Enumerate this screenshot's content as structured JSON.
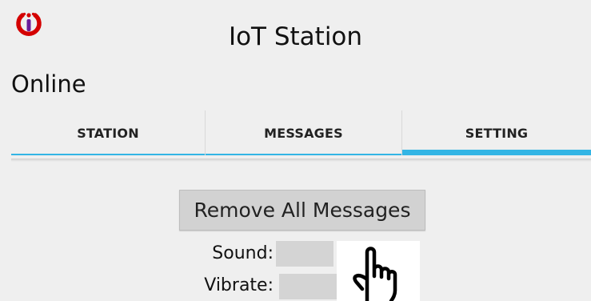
{
  "header": {
    "title": "IoT Station",
    "status": "Online",
    "logo_icon": "power-logo-icon",
    "logo_colors": {
      "ring": "#d40000",
      "dot_top": "#ffffff",
      "dot_center": "#6a1b9a"
    }
  },
  "tabs": [
    {
      "label": "STATION",
      "active": false
    },
    {
      "label": "MESSAGES",
      "active": false
    },
    {
      "label": "SETTING",
      "active": true
    }
  ],
  "accent_color": "#33b5e5",
  "settings": {
    "remove_button_label": "Remove All Messages",
    "sound_label": "Sound:",
    "vibrate_label": "Vibrate:",
    "pointer_icon": "hand-pointer-icon"
  }
}
